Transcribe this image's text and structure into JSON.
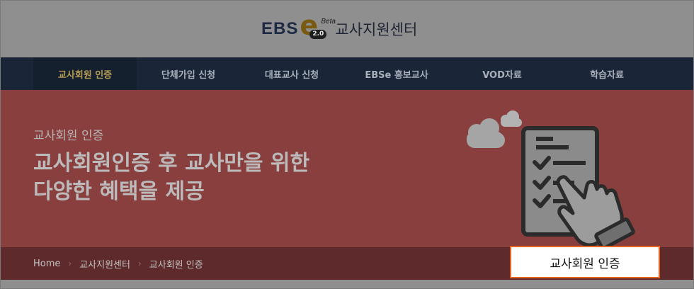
{
  "header": {
    "logo_ebs": "EBS",
    "logo_e": "e",
    "logo_version": "2.0",
    "logo_beta": "Beta",
    "site_title": "교사지원센터"
  },
  "nav": {
    "items": [
      {
        "label": "교사회원 인증",
        "active": true
      },
      {
        "label": "단체가입 신청",
        "active": false
      },
      {
        "label": "대표교사 신청",
        "active": false
      },
      {
        "label": "EBSe 홍보교사",
        "active": false
      },
      {
        "label": "VOD자료",
        "active": false
      },
      {
        "label": "학습자료",
        "active": false
      }
    ]
  },
  "hero": {
    "subtitle": "교사회원 인증",
    "title_line1": "교사회원인증 후 교사만을 위한",
    "title_line2": "다양한 혜택을 제공"
  },
  "breadcrumb": {
    "items": [
      "Home",
      "교사지원센터",
      "교사회원 인증"
    ],
    "separator": "›"
  },
  "callout": {
    "label": "교사회원 인증",
    "border_color": "#e8641e"
  },
  "colors": {
    "nav_bg": "#1a2537",
    "nav_active_text": "#b39a52",
    "hero_bg": "#8a3f3f",
    "breadcrumb_bg": "#5f2a2c"
  }
}
